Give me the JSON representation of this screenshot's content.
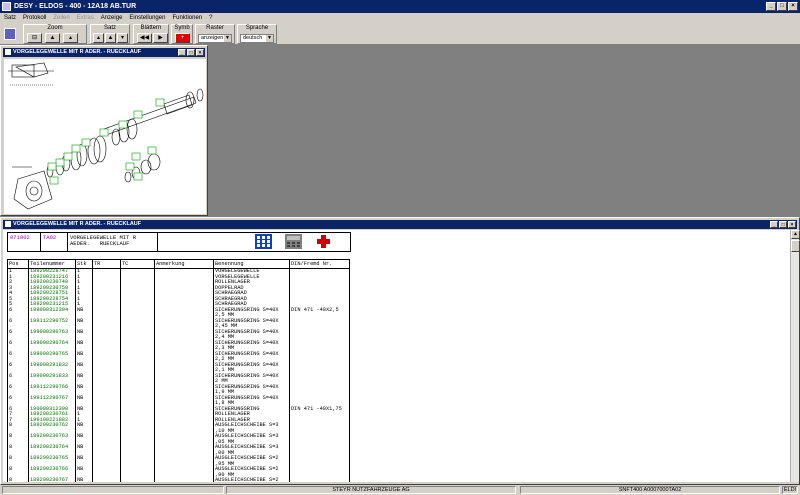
{
  "app": {
    "title": "DESY - ELDOS - 400 - 12A18 AB.TUR"
  },
  "menu": [
    "Satz",
    "Protokoll",
    "Zeilen",
    "Extras",
    "Anzeige",
    "Einstellungen",
    "Funktionen",
    "?"
  ],
  "menu_disabled": [
    "Zeilen",
    "Extras"
  ],
  "toolbar": {
    "zoom_label": "Zoom",
    "satz_label": "Satz",
    "blaettern_label": "Blättern",
    "symb_label": "Symb",
    "raster_label": "Raster",
    "sprache_label": "Sprache",
    "raster_value": "anzeigen",
    "sprache_value": "deutsch"
  },
  "drawing_window": {
    "title": "VORGELEGEWELLE MIT R ADER.  - RUECKLAUF"
  },
  "parts_window": {
    "title": "VORGELEGEWELLE MIT R ADER.  - RUECKLAUF"
  },
  "header": {
    "code1": "071002",
    "code2": "TA02",
    "desc": "VORGELEGEWELLE MIT R\nAEDER.   RUECKLAUF"
  },
  "columns": [
    "Pos",
    "Teilenummer",
    "Stk",
    "TR",
    "TC",
    "Anmerkung",
    "Benennung",
    "DIN/Fremd Nr."
  ],
  "rows": [
    [
      "1",
      "189200228747",
      "1",
      "",
      "",
      "",
      "VORGELEGEWELLE",
      ""
    ],
    [
      "1",
      "189200231216",
      "1",
      "",
      "",
      "",
      "VORGELEGEWELLE",
      ""
    ],
    [
      "2",
      "189200230748",
      "1",
      "",
      "",
      "",
      "ROLLENLAGER",
      ""
    ],
    [
      "3",
      "189200230750",
      "1",
      "",
      "",
      "",
      "DOPPELRAD",
      ""
    ],
    [
      "4",
      "189200228751",
      "1",
      "",
      "",
      "",
      "SCHRAEGRAD",
      ""
    ],
    [
      "5",
      "189200228754",
      "1",
      "",
      "",
      "",
      "SCHRAEGRAD",
      ""
    ],
    [
      "5",
      "189200231215",
      "1",
      "",
      "",
      "",
      "SCHRAEGRAD",
      ""
    ],
    [
      "6",
      "199000312304",
      "NB",
      "",
      "",
      "",
      "SICHERUNGSRING S=40X\n2,5 MM",
      "DIN 471 -40X2,5"
    ],
    [
      "6",
      "199112290752",
      "NB",
      "",
      "",
      "",
      "SICHERUNGSRING S=40X\n2,45 MM",
      ""
    ],
    [
      "6",
      "199000290763",
      "NB",
      "",
      "",
      "",
      "SICHERUNGSRING S=40X\n2,4 MM",
      ""
    ],
    [
      "6",
      "199000290764",
      "NB",
      "",
      "",
      "",
      "SICHERUNGSRING S=40X\n2,3 MM",
      ""
    ],
    [
      "6",
      "199000290765",
      "NB",
      "",
      "",
      "",
      "SICHERUNGSRING S=40X\n2,2 MM",
      ""
    ],
    [
      "6",
      "199000291832",
      "NB",
      "",
      "",
      "",
      "SICHERUNGSRING S=40X\n2,1 MM",
      ""
    ],
    [
      "6",
      "199000291833",
      "NB",
      "",
      "",
      "",
      "SICHERUNGSRING S=40X\n2 MM",
      ""
    ],
    [
      "6",
      "199112290766",
      "NB",
      "",
      "",
      "",
      "SICHERUNGSRING S=40X\n1,9 MM",
      ""
    ],
    [
      "6",
      "199112290767",
      "NB",
      "",
      "",
      "",
      "SICHERUNGSRING S=40X\n1,8 MM",
      ""
    ],
    [
      "6",
      "190000312300",
      "NB",
      "",
      "",
      "",
      "SICHERUNGSRING",
      "DIN 471 -40X1,75"
    ],
    [
      "7",
      "189200230761",
      "1",
      "",
      "",
      "",
      "ROLLENLAGER",
      ""
    ],
    [
      "7",
      "199100221882",
      "1",
      "",
      "",
      "",
      "ROLLENLAGER",
      ""
    ],
    [
      "8",
      "189200230762",
      "NB",
      "",
      "",
      "",
      "AUSGLEICHSCHEIBE S=3\n,10 MM",
      ""
    ],
    [
      "8",
      "189200230763",
      "NB",
      "",
      "",
      "",
      "AUSGLEICHSCHEIBE S=3\n,05 MM",
      ""
    ],
    [
      "8",
      "189200230764",
      "NB",
      "",
      "",
      "",
      "AUSGLEICHSCHEIBE S=3\n,00 MM",
      ""
    ],
    [
      "8",
      "189200230765",
      "NB",
      "",
      "",
      "",
      "AUSGLEICHSCHEIBE S=2\n,95 MM",
      ""
    ],
    [
      "8",
      "189200230766",
      "NB",
      "",
      "",
      "",
      "AUSGLEICHSCHEIBE S=2\n,90 MM",
      ""
    ],
    [
      "8",
      "189200230767",
      "NB",
      "",
      "",
      "",
      "AUSGLEICHSCHEIBE S=2",
      ""
    ]
  ],
  "status": {
    "company": "STEYR NUTZFAHRZEUGE AG",
    "file": "SNFT400 A0007000TA02",
    "app": "ELDI"
  }
}
